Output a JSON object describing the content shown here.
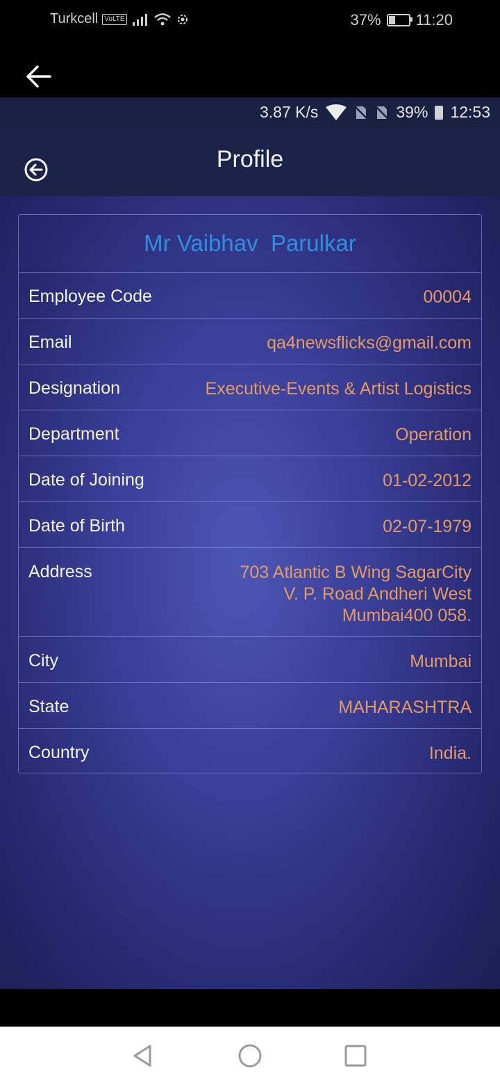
{
  "outer_status": {
    "carrier": "Turkcell",
    "volte": "VoLTE",
    "battery": "37%",
    "time": "11:20",
    "battery_level": 0.37
  },
  "inner_status": {
    "speed": "3.87 K/s",
    "battery": "39%",
    "time": "12:53"
  },
  "header": {
    "title": "Profile"
  },
  "profile": {
    "name": "Mr Vaibhav  Parulkar",
    "rows": [
      {
        "label": "Employee Code",
        "value": "00004"
      },
      {
        "label": "Email",
        "value": "qa4newsflicks@gmail.com"
      },
      {
        "label": "Designation",
        "value": "Executive-Events & Artist Logistics"
      },
      {
        "label": "Department",
        "value": "Operation"
      },
      {
        "label": "Date of Joining",
        "value": "01-02-2012"
      },
      {
        "label": "Date of Birth",
        "value": "02-07-1979"
      },
      {
        "label": "Address",
        "value_lines": [
          "703 Atlantic B Wing SagarCity",
          "V. P. Road Andheri West",
          "Mumbai400 058."
        ]
      },
      {
        "label": "City",
        "value": "Mumbai"
      },
      {
        "label": "State",
        "value": "MAHARASHTRA"
      },
      {
        "label": "Country",
        "value": "India."
      }
    ]
  },
  "icons": {
    "back": "back-arrow-icon",
    "back_circle": "back-circle-icon",
    "nav": [
      "back-triangle-icon",
      "home-circle-icon",
      "recents-square-icon"
    ]
  },
  "colors": {
    "name": "#2f8fdc",
    "value": "#e39a63",
    "label": "#f4f4f4"
  }
}
